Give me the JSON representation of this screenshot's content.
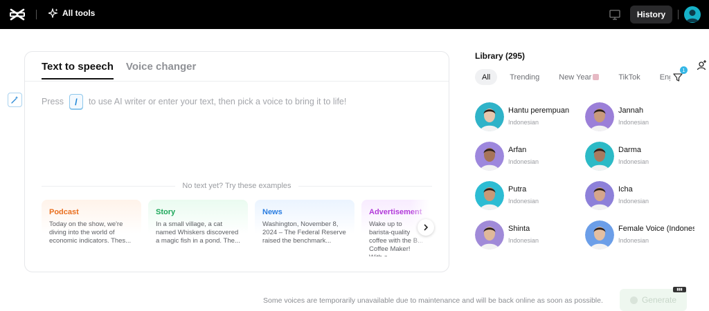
{
  "topbar": {
    "all_tools_label": "All tools",
    "history_label": "History"
  },
  "editor": {
    "tabs": [
      {
        "label": "Text to speech",
        "active": true
      },
      {
        "label": "Voice changer",
        "active": false
      }
    ],
    "prompt_before": "Press",
    "slash_key": "/",
    "prompt_after": "to use AI writer or enter your text, then pick a voice to bring it to life!",
    "examples_title": "No text yet? Try these examples",
    "examples": [
      {
        "title": "Podcast",
        "text": "Today on the show, we're diving into the world of economic indicators. Thes..."
      },
      {
        "title": "Story",
        "text": "In a small village, a cat named Whiskers discovered a magic fish in a pond. The..."
      },
      {
        "title": "News",
        "text": "Washington, November 8, 2024 – The Federal Reserve raised the benchmark..."
      },
      {
        "title": "Advertisement",
        "text": "Wake up to barista-quality coffee with the B... Coffee Maker! With a..."
      }
    ]
  },
  "library": {
    "title": "Library (295)",
    "filter_badge": "1",
    "chips": [
      {
        "label": "All",
        "active": true
      },
      {
        "label": "Trending",
        "active": false
      },
      {
        "label": "New Year",
        "active": false
      },
      {
        "label": "TikTok",
        "active": false
      },
      {
        "label": "English",
        "active": false
      }
    ],
    "voices": [
      {
        "name": "Hantu perempuan",
        "lang": "Indonesian",
        "bg": "#2fb3c8",
        "skin": "#e8c7ae"
      },
      {
        "name": "Jannah",
        "lang": "Indonesian",
        "bg": "#9b7fd8",
        "skin": "#c99a7c"
      },
      {
        "name": "Arfan",
        "lang": "Indonesian",
        "bg": "#9d87dd",
        "skin": "#a6745a"
      },
      {
        "name": "Darma",
        "lang": "Indonesian",
        "bg": "#2cbac6",
        "skin": "#a97a5f"
      },
      {
        "name": "Putra",
        "lang": "Indonesian",
        "bg": "#2cbcd3",
        "skin": "#c99877"
      },
      {
        "name": "Icha",
        "lang": "Indonesian",
        "bg": "#8d80d9",
        "skin": "#d5a68b"
      },
      {
        "name": "Shinta",
        "lang": "Indonesian",
        "bg": "#a08ad8",
        "skin": "#e0b99a"
      },
      {
        "name": "Female Voice (Indonesian)",
        "lang": "Indonesian",
        "bg": "#6b9ee8",
        "skin": "#e3bfa2"
      }
    ]
  },
  "footer": {
    "notice": "Some voices are temporarily unavailable due to maintenance and will be back online as soon as possible.",
    "generate_label": "Generate"
  }
}
